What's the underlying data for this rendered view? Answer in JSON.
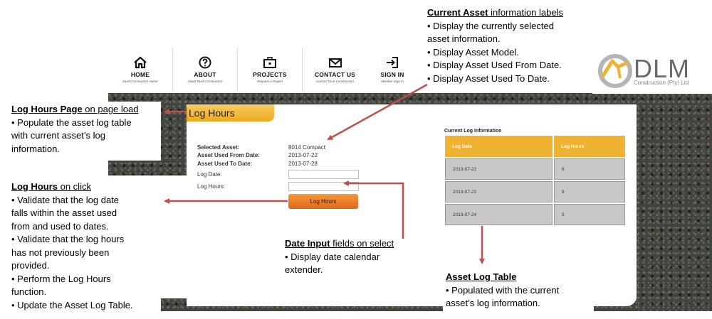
{
  "nav": {
    "items": [
      {
        "label": "HOME",
        "sub": "DLM Construction Home",
        "icon": "home-icon"
      },
      {
        "label": "ABOUT",
        "sub": "About DLM Construction",
        "icon": "question-icon"
      },
      {
        "label": "PROJECTS",
        "sub": "Request a Project",
        "icon": "briefcase-icon"
      },
      {
        "label": "CONTACT US",
        "sub": "Contact DLM Construction",
        "icon": "envelope-icon"
      },
      {
        "label": "SIGN IN",
        "sub": "Member Sign In",
        "icon": "sign-in-icon"
      }
    ]
  },
  "logo": {
    "name": "DLM",
    "sub": "Construction (Pty) Ltd"
  },
  "page": {
    "title": "Log Hours"
  },
  "form": {
    "selected_asset_label": "Selected Asset:",
    "selected_asset_value": "8014 Compact",
    "used_from_label": "Asset Used From Date:",
    "used_from_value": "2013-07-22",
    "used_to_label": "Asset Used To Date:",
    "used_to_value": "2013-07-28",
    "log_date_label": "Log Date:",
    "log_date_value": "",
    "log_hours_label": "Log Hours:",
    "log_hours_value": "",
    "button_label": "Log Hours"
  },
  "log_table": {
    "title": "Current Log Information",
    "headers": [
      "Log Date",
      "Log Hours"
    ],
    "rows": [
      [
        "2013-07-22",
        "6"
      ],
      [
        "2013-07-23",
        "9"
      ],
      [
        "2013-07-24",
        "5"
      ]
    ]
  },
  "annotations": {
    "current_asset": {
      "heading": "Current Asset",
      "heading_rest": " information labels",
      "lines": [
        "• Display the currently selected",
        "asset information.",
        "• Display Asset Model.",
        "• Display Asset Used From Date.",
        "• Display Asset Used To Date."
      ]
    },
    "page_load": {
      "heading": "Log Hours Page",
      "heading_rest": " on page load",
      "lines": [
        "• Populate the asset log table",
        "with current  asset’s log",
        "information."
      ]
    },
    "on_click": {
      "heading": "Log Hours",
      "heading_rest": " on click",
      "lines": [
        "• Validate that the log date",
        "falls within the asset used",
        "from and used to dates.",
        "• Validate that the log hours",
        "has not previously been",
        "provided.",
        "• Perform  the  Log Hours",
        "function.",
        "• Update the Asset Log Table."
      ]
    },
    "date_input": {
      "heading": "Date Input",
      "heading_rest": " fields on select",
      "lines": [
        "• Display date calendar",
        "extender."
      ]
    },
    "asset_log": {
      "heading": "Asset Log Table",
      "heading_rest": "",
      "lines": [
        "• Populated with the current",
        "asset’s log information."
      ]
    }
  },
  "colors": {
    "accent_orange": "#f0b232",
    "button_orange": "#e5641a",
    "arrow": "#c0504d"
  }
}
